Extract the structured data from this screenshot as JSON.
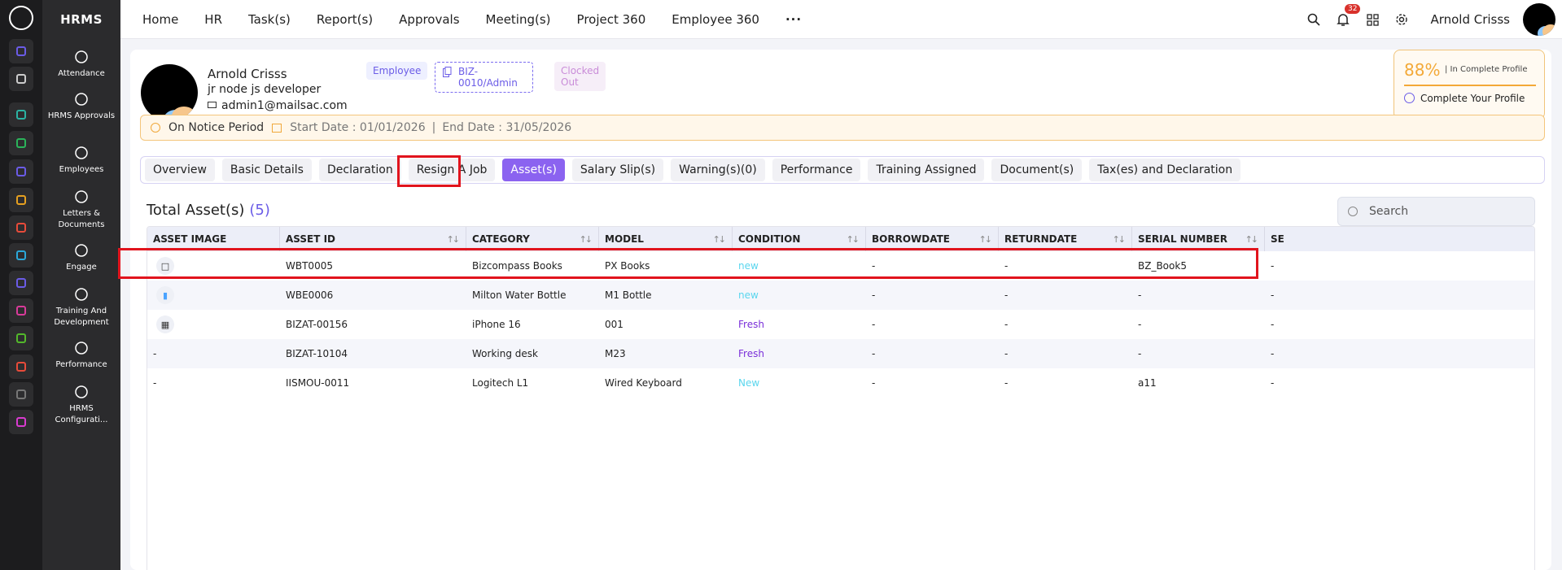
{
  "app": {
    "name": "HRMS"
  },
  "sidenav": [
    {
      "label": "Attendance",
      "icon": "attendance-icon"
    },
    {
      "label": "HRMS Approvals",
      "icon": "approvals-icon"
    },
    {
      "label": "Employees",
      "icon": "employees-icon"
    },
    {
      "label": "Letters & Documents",
      "icon": "letters-icon"
    },
    {
      "label": "Engage",
      "icon": "engage-icon"
    },
    {
      "label": "Training And Development",
      "icon": "training-icon"
    },
    {
      "label": "Performance",
      "icon": "performance-icon"
    },
    {
      "label": "HRMS Configurati...",
      "icon": "config-icon"
    }
  ],
  "rail_colors": [
    "#6b5ce7",
    "#cccccc",
    "#2bb3a3",
    "#2bb35a",
    "#6b5ce7",
    "#e6a020",
    "#e84b3a",
    "#2ba8d9",
    "#6b5ce7",
    "#d93b9a",
    "#53b82b",
    "#e84b3a",
    "#777777",
    "#d93bd0"
  ],
  "topnav": [
    "Home",
    "HR",
    "Task(s)",
    "Report(s)",
    "Approvals",
    "Meeting(s)",
    "Project 360",
    "Employee 360"
  ],
  "topbar": {
    "notifications": "32",
    "user": "Arnold Crisss"
  },
  "profile": {
    "name": "Arnold Crisss",
    "type": "Employee",
    "code": "BIZ-0010/Admin",
    "status": "Clocked Out",
    "role": "jr node js developer",
    "email": "admin1@mailsac.com",
    "completion": "88%",
    "completion_text": "| In Complete Profile",
    "complete_cta": "Complete Your Profile"
  },
  "notice": {
    "title": "On Notice Period",
    "start": "Start Date : 01/01/2026",
    "sep": "|",
    "end": "End Date : 31/05/2026"
  },
  "tabs": [
    "Overview",
    "Basic Details",
    "Declaration",
    "Resign A Job",
    "Asset(s)",
    "Salary Slip(s)",
    "Warning(s)(0)",
    "Performance",
    "Training Assigned",
    "Document(s)",
    "Tax(es) and Declaration"
  ],
  "active_tab": "Asset(s)",
  "assets": {
    "title": "Total Asset(s)",
    "count": "(5)",
    "search_placeholder": "Search",
    "columns": [
      "ASSET IMAGE",
      "ASSET ID",
      "CATEGORY",
      "MODEL",
      "CONDITION",
      "BORROWDATE",
      "RETURNDATE",
      "SERIAL NUMBER",
      "SE"
    ],
    "rows": [
      {
        "image": "book-icon",
        "image_text": "",
        "id": "WBT0005",
        "category": "Bizcompass Books",
        "model": "PX Books",
        "condition": "new",
        "condition_style": "new",
        "borrow": "-",
        "return": "-",
        "serial": "BZ_Book5",
        "extra": "-"
      },
      {
        "image": "bottle-icon",
        "image_text": "",
        "id": "WBE0006",
        "category": "Milton Water Bottle",
        "model": "M1 Bottle",
        "condition": "new",
        "condition_style": "new",
        "borrow": "-",
        "return": "-",
        "serial": "-",
        "extra": "-"
      },
      {
        "image": "qr-icon",
        "image_text": "",
        "id": "BIZAT-00156",
        "category": "iPhone 16",
        "model": "001",
        "condition": "Fresh",
        "condition_style": "fresh",
        "borrow": "-",
        "return": "-",
        "serial": "-",
        "extra": "-"
      },
      {
        "image": "",
        "image_text": "-",
        "id": "BIZAT-10104",
        "category": "Working desk",
        "model": "M23",
        "condition": "Fresh",
        "condition_style": "fresh",
        "borrow": "-",
        "return": "-",
        "serial": "-",
        "extra": "-"
      },
      {
        "image": "",
        "image_text": "-",
        "id": "IISMOU-0011",
        "category": "Logitech L1",
        "model": "Wired Keyboard",
        "condition": "New",
        "condition_style": "new",
        "borrow": "-",
        "return": "-",
        "serial": "a11",
        "extra": "-"
      }
    ]
  }
}
